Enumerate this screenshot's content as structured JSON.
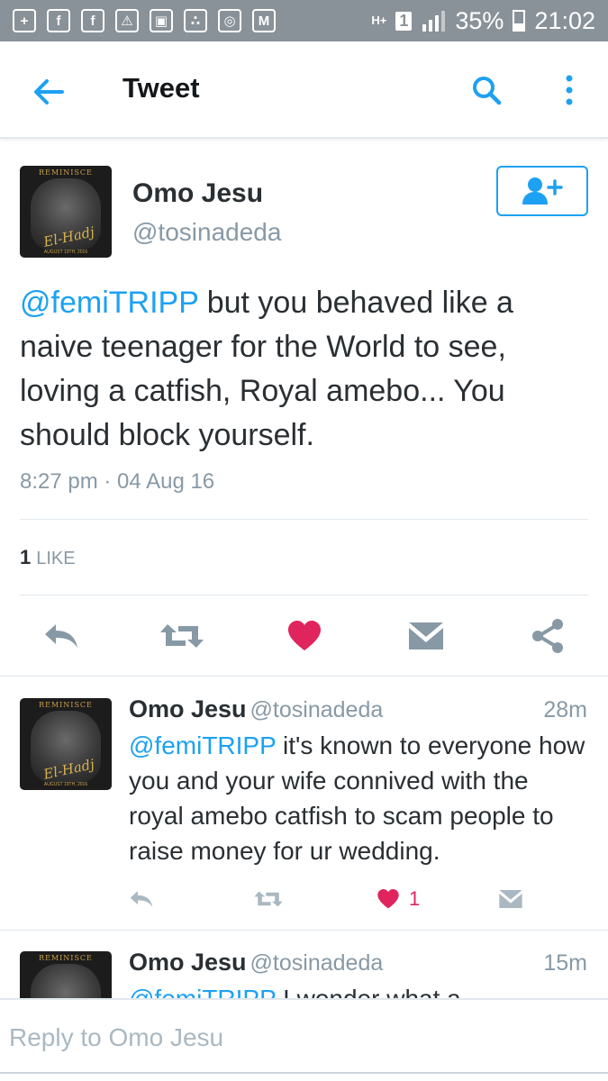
{
  "status_bar": {
    "icons": [
      "plus-icon",
      "facebook-icon",
      "facebook-icon",
      "accessibility-icon",
      "gallery-icon",
      "bbm-icon",
      "instagram-icon",
      "gmail-icon"
    ],
    "network": "H+",
    "sim": "1",
    "battery": "35%",
    "time": "21:02"
  },
  "app_bar": {
    "title": "Tweet"
  },
  "tweet": {
    "name": "Omo Jesu",
    "handle": "@tosinadeda",
    "mention": "@femiTRIPP",
    "text": " but you behaved like a naive teenager for the World to see, loving a catfish, Royal amebo... You should block yourself.",
    "timestamp": "8:27 pm · 04 Aug 16",
    "like_count": "1",
    "like_label": "LIKE"
  },
  "avatar": {
    "top_text": "REMINISCE",
    "script_text": "El-Hadj",
    "bottom_text": "AUGUST 19TH, 2016"
  },
  "replies": [
    {
      "name": "Omo Jesu",
      "handle": "@tosinadeda",
      "time": "28m",
      "mention": "@femiTRIPP",
      "text": " it's known to everyone how you and your wife connived with the royal amebo catfish to scam people to raise money for ur wedding.",
      "like_count": "1"
    },
    {
      "name": "Omo Jesu",
      "handle": "@tosinadeda",
      "time": "15m",
      "mention": "@femiTRIPP",
      "text": " I wonder what a"
    }
  ],
  "reply_bar": {
    "placeholder": "Reply to Omo Jesu"
  },
  "colors": {
    "accent": "#1da1f2",
    "like": "#e0245e",
    "icon_gray": "#8899a6",
    "status_bar": "#8a9299"
  }
}
